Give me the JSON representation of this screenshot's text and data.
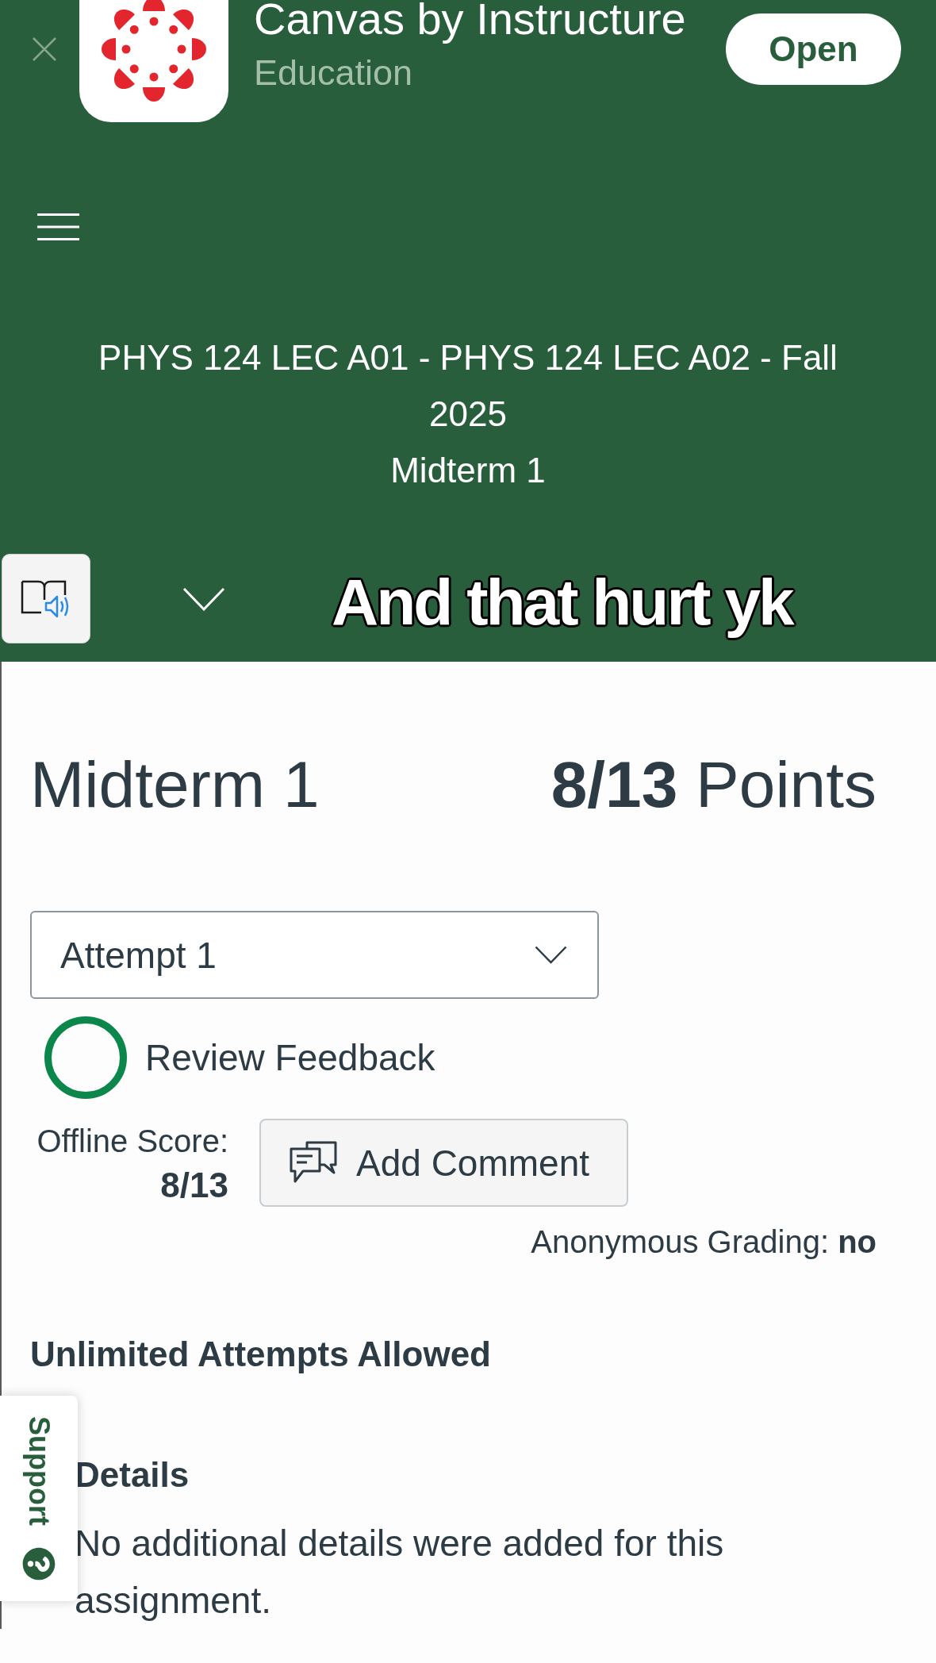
{
  "app_banner": {
    "app_name": "Canvas by Instructure",
    "category": "Education",
    "open_button": "Open"
  },
  "header": {
    "course_title": "PHYS 124 LEC A01 - PHYS 124 LEC A02 - Fall 2025",
    "page_title": "Midterm 1"
  },
  "caption_overlay": {
    "text": "And that hurt yk"
  },
  "assignment": {
    "title": "Midterm 1",
    "points": "**8/13** Points",
    "attempt_select": {
      "value": "Attempt 1"
    },
    "review_feedback": "Review Feedback",
    "offline_score": {
      "label": "Offline Score:",
      "value": "8/13"
    },
    "add_comment_button": "Add Comment",
    "anonymous_grading": "Anonymous Grading: **no**",
    "attempts_note": "Unlimited Attempts Allowed"
  },
  "details": {
    "heading": "Details",
    "text": "No additional details were added for this assignment."
  },
  "support_tab": {
    "label": "Support"
  }
}
